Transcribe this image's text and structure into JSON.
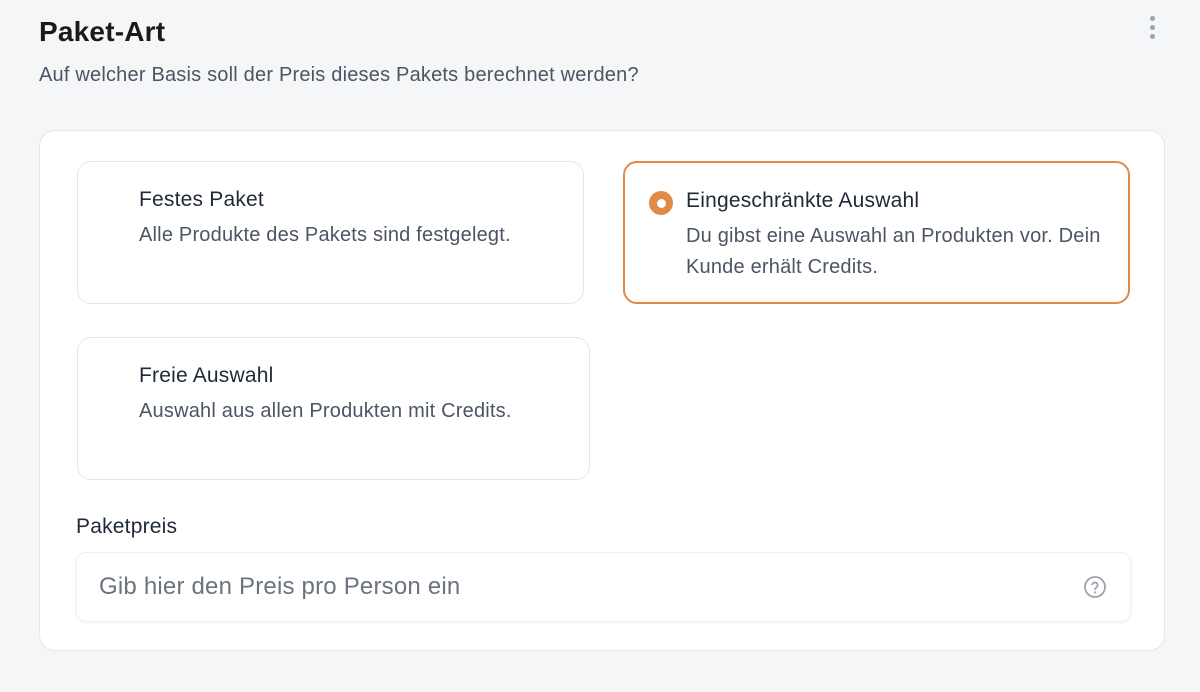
{
  "header": {
    "title": "Paket-Art",
    "subtitle": "Auf welcher Basis soll der Preis dieses Pakets berechnet werden?",
    "more_icon": "more-vertical-icon"
  },
  "options": [
    {
      "title": "Festes Paket",
      "description": "Alle Produkte des Pakets sind festgelegt.",
      "selected": false
    },
    {
      "title": "Eingeschränkte Auswahl",
      "description": "Du gibst eine Auswahl an Produkten vor. Dein Kunde erhält Credits.",
      "selected": true
    },
    {
      "title": "Freie Auswahl",
      "description": "Auswahl aus allen Produkten mit Credits.",
      "selected": false
    }
  ],
  "price": {
    "label": "Paketpreis",
    "placeholder": "Gib hier den Preis pro Person ein",
    "value": "",
    "help_icon": "question-circle-icon"
  },
  "colors": {
    "accent": "#e08a46",
    "background": "#f5f6f8",
    "card": "#ffffff",
    "border": "#e5e7eb"
  }
}
